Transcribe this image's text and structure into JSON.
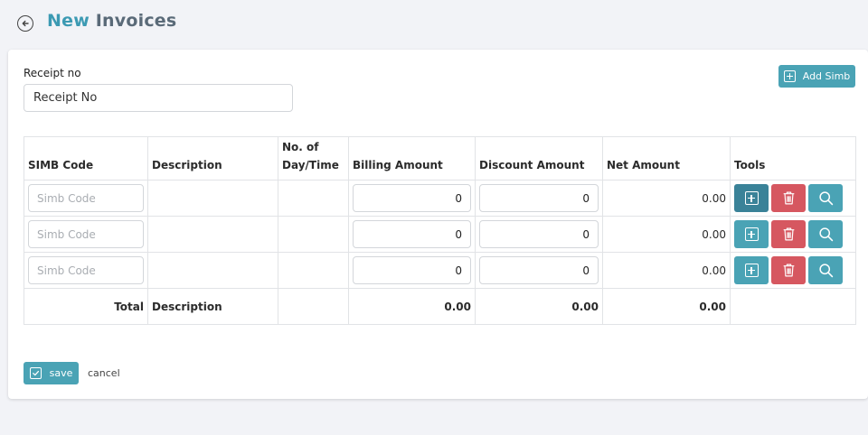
{
  "header": {
    "title_part1": "New",
    "title_part2": "Invoices"
  },
  "form": {
    "receipt_label": "Receipt no",
    "receipt_placeholder": "Receipt No",
    "add_simb_label": "Add Simb"
  },
  "table": {
    "columns": [
      "SIMB Code",
      "Description",
      "No. of Day/Time",
      "Billing Amount",
      "Discount Amount",
      "Net Amount",
      "Tools"
    ],
    "rows": [
      {
        "simb_placeholder": "Simb Code",
        "billing": "0",
        "discount": "0",
        "net": "0.00"
      },
      {
        "simb_placeholder": "Simb Code",
        "billing": "0",
        "discount": "0",
        "net": "0.00"
      },
      {
        "simb_placeholder": "Simb Code",
        "billing": "0",
        "discount": "0",
        "net": "0.00"
      }
    ],
    "total": {
      "label": "Total",
      "description": "Description",
      "billing": "0.00",
      "discount": "0.00",
      "net": "0.00"
    }
  },
  "footer": {
    "save_label": "save",
    "cancel_label": "cancel"
  },
  "colors": {
    "accent": "#4aa3b5",
    "accent_dark": "#3a8298",
    "danger": "#d65760",
    "title_accent": "#3c9ab3",
    "title_muted": "#5a6a78"
  },
  "icons": {
    "back": "back-arrow-circle-icon",
    "add": "plus-square-icon",
    "delete": "trash-icon",
    "search": "search-icon",
    "save": "check-square-icon"
  }
}
